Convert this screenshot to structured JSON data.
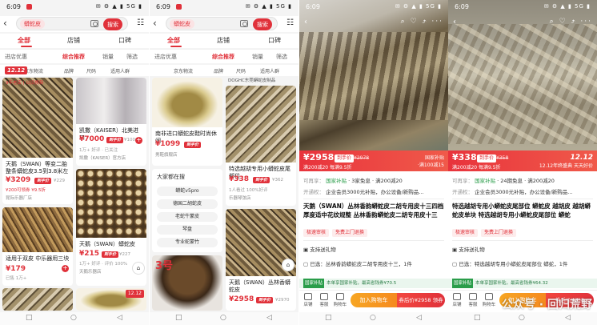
{
  "status": {
    "time": "6:09",
    "icons": "✉ ⚙ ▲ ▮ 5G ▮"
  },
  "p1": {
    "query": "蟒蛇皮",
    "search_btn": "搜索",
    "tabs": [
      "全部",
      "店铺",
      "口碑"
    ],
    "filters": [
      "进店优惠",
      "综合推荐",
      "销量",
      "筛选"
    ],
    "service": [
      "京东物流",
      "品牌",
      "尺码",
      "适用人群"
    ],
    "promo_tag": "12.12",
    "card1": {
      "promo": "9年老店 | 以旧换新",
      "title": "天鹅（SWAN）等变二胎 整条蟒蛇皮3.5到3.8米左",
      "price": "¥3209",
      "price_tag": "到手价",
      "sub": "¥229",
      "sub2": "¥200可领券 ¥9.5折",
      "shop": "昆际乐器厂店"
    },
    "card2": {
      "title": "凯撒（KAISER）北美进口 ",
      "price": "¥7000",
      "price_tag": "到手价",
      "sub": "¥10000",
      "sub2": "1万+ 好评 · 已关注",
      "shop": "凯撒（KAISER）官方店"
    },
    "card3": {
      "title": "天鹅（SWAN）蟒蛇皮",
      "price": "¥215",
      "price_tag": "到手价",
      "sub": "¥227",
      "sub2": "1万+ 好评 · 评价 100%",
      "shop": "天鹅乐器店"
    },
    "card4": {
      "title": "适用于双皮 中乐器用三块",
      "price": "¥179",
      "sub2": "已售 1万+",
      "shop": "乐器配件店"
    },
    "card5": {
      "promo": "12.12"
    },
    "nav": [
      "□",
      "○",
      "◁"
    ]
  },
  "p2": {
    "query": "蟒蛇皮",
    "search_btn": "搜索",
    "tabs": [
      "全部",
      "店铺",
      "口碑"
    ],
    "filters": [
      "进店优惠",
      "综合推荐",
      "销量",
      "筛选"
    ],
    "service": [
      "京东物流",
      "品牌",
      "尺码",
      "适用人群"
    ],
    "banner": "DOGHC东莞蟒蛇皮制品",
    "card1": {
      "title": "南非进口蟒蛇皮鞋时尚休闲",
      "price": "¥1099",
      "price_tag": "到手价",
      "shop": "男鞋旗舰店"
    },
    "card2": {
      "title": "特选越胡专用小蟒蛇皮尾部位",
      "price": "¥338",
      "price_tag": "到手价",
      "sub": "¥362",
      "sub2": "1人看过 100%好评",
      "shop": "乐器琴弦店"
    },
    "sugg": {
      "head": "大家都在搜",
      "items": [
        "蟒蛇v5pro",
        "德国二胡蛇皮",
        "老蛇牛蒙皮",
        "琴盘",
        "专业蛇蒙竹"
      ]
    },
    "card3": {
      "badge": "3号"
    },
    "card4": {
      "title": "天鹅（SWAN）丛林香蟒蛇皮",
      "price": "¥2958",
      "price_tag": "到手价",
      "sub": "¥2970"
    },
    "nav": [
      "□",
      "○",
      "◁"
    ]
  },
  "p3": {
    "price": "¥2958",
    "price_badge": "到手价",
    "price_old": "¥2978",
    "price_note": "满200减20 每满9.5折",
    "right_badge": "国家补贴",
    "right_sub": "·满100减15",
    "row1_label": "可再享：",
    "row1_a": "国家补贴",
    "row1_b": "3家免息",
    "row1_c": "满200减20",
    "row2_label": "开通权：",
    "row2_text": "企业会员3000元补贴，办公设备/新购品...",
    "title": "天鹅（SWAN）丛林香韵蟒蛇皮二胡专用皮十三四档 厚度适中花纹规整 丛林香韵蟒蛇皮二胡专用皮十三",
    "chips": [
      "极速审核",
      "免费上门退换"
    ],
    "support": "支持送礼物",
    "selected": "已选：丛林香韵蟒蛇皮二胡专用皮十三，1件",
    "green_tag": "国家补贴",
    "green_text": "本单享国家补贴，最高省钱券¥70.5",
    "bottom": [
      "店铺",
      "客服",
      "购物车"
    ],
    "btn_cart": "加入购物车",
    "btn_buy": "券后价¥2958 领券购买",
    "nav": [
      "□",
      "○",
      "◁"
    ]
  },
  "p4": {
    "price": "¥338",
    "price_badge": "到手价",
    "price_old": "¥358",
    "price_note": "满200减20 每满9.5折",
    "right_badge": "12.12",
    "right_sub": "12.12年终盛典 天天好价",
    "row1_label": "可再享：",
    "row1_a": "国家补贴",
    "row1_b": "24期免息",
    "row1_c": "满200减20",
    "row2_label": "开通权：",
    "row2_text": "企业会员3000元补贴，办公设备/新购品...",
    "title": "特选越胡专用小蟒蛇皮尾部位 蟒蛇皮 越胡皮 越胡蟒蛇皮单块 特选越胡专用小蟒蛇皮尾部位 蟒蛇",
    "chips": [
      "极速审核",
      "免费上门退换"
    ],
    "support": "支持送礼物",
    "selected": "已选：特选越胡专用小蟒蛇皮尾部位 蟒蛇，1件",
    "green_tag": "国家补贴",
    "green_text": "本单享国家补贴，最高省钱券¥64.32",
    "bottom": [
      "店铺",
      "客服",
      "购物车"
    ],
    "btn_cart": "加入购物车",
    "btn_buy": "券后价¥338",
    "watermark": "公众号 · 回归荒野",
    "nav": [
      "□",
      "○",
      "◁"
    ]
  }
}
